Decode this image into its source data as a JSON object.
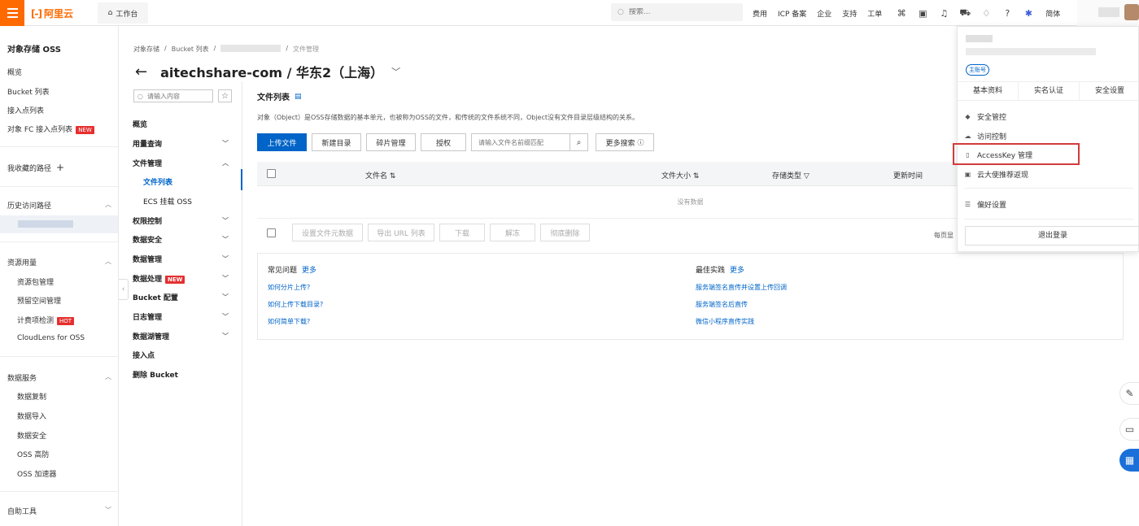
{
  "topbar": {
    "logo_text": "阿里云",
    "workbench": "工作台",
    "search_placeholder": "搜索...",
    "nav": [
      "费用",
      "ICP 备案",
      "企业",
      "支持",
      "工单"
    ],
    "lang": "简体",
    "icons": [
      "terminal-icon",
      "message-icon",
      "bell-icon",
      "cart-icon",
      "bulb-icon",
      "help-icon",
      "ai-icon"
    ]
  },
  "left": {
    "title": "对象存储 OSS",
    "overview": "概览",
    "bucket_list": "Bucket 列表",
    "access_points": "接入点列表",
    "fc_access": "对象 FC 接入点列表",
    "new_badge": "NEW",
    "fav_paths": "我收藏的路径",
    "history": "历史访问路径",
    "resources": "资源用量",
    "res_items": [
      "资源包管理",
      "预留空间管理",
      "计费项检测"
    ],
    "hot_badge": "HOT",
    "cloudlens": "CloudLens for OSS",
    "data_services": "数据服务",
    "data_items": [
      "数据复制",
      "数据导入",
      "数据安全",
      "OSS 高防",
      "OSS 加速器"
    ],
    "self_tools": "自助工具"
  },
  "breadcrumb": {
    "items": [
      "对象存储",
      "Bucket 列表"
    ],
    "current": "文件管理"
  },
  "header": {
    "title": "aitechshare-com / 华东2（上海）"
  },
  "subnav": {
    "search_placeholder": "请输入内容",
    "items": [
      "概览",
      "用量查询",
      "文件管理",
      "文件列表",
      "ECS 挂载 OSS",
      "权限控制",
      "数据安全",
      "数据管理",
      "数据处理",
      "Bucket 配置",
      "日志管理",
      "数据湖管理",
      "接入点",
      "删除 Bucket"
    ],
    "new_badge": "NEW"
  },
  "main": {
    "title": "文件列表",
    "desc": "对象（Object）是OSS存储数据的基本单元，也被称为OSS的文件，和传统的文件系统不同，Object没有文件目录层级结构的关系。",
    "buttons": [
      "上传文件",
      "新建目录",
      "碎片管理",
      "授权"
    ],
    "file_search_placeholder": "请输入文件名前缀匹配",
    "more_search": "更多搜索",
    "columns": [
      "文件名",
      "文件大小",
      "存储类型",
      "更新时间"
    ],
    "empty": "没有数据",
    "batch": [
      "设置文件元数据",
      "导出 URL 列表",
      "下载",
      "解冻",
      "彻底删除"
    ],
    "per_page": "每页显"
  },
  "faq": {
    "left_title": "常见问题",
    "left_more": "更多",
    "left_links": [
      "如何分片上传?",
      "如何上传下载目录?",
      "如何简单下载?"
    ],
    "right_title": "最佳实践",
    "right_more": "更多",
    "right_links": [
      "服务端签名直传并设置上传回调",
      "服务端签名后直传",
      "微信小程序直传实践"
    ]
  },
  "dropdown": {
    "account_badge": "主账号",
    "tabs": [
      "基本资料",
      "实名认证",
      "安全设置"
    ],
    "items": [
      "安全管控",
      "访问控制",
      "AccessKey 管理",
      "云大使推荐返现",
      "偏好设置"
    ],
    "logout": "退出登录"
  },
  "colors": {
    "brand": "#ff6a00",
    "primary": "#0064c8",
    "highlight": "#d23b3b"
  }
}
